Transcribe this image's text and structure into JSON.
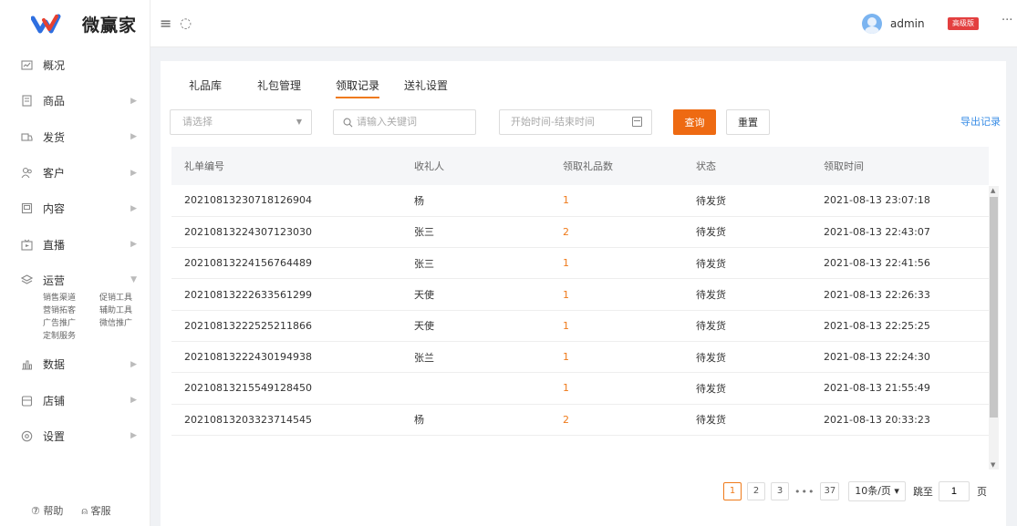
{
  "app": {
    "logo_text": "微赢家",
    "accent": "#ee6a12",
    "link": "#3a8ee6"
  },
  "sidebar": {
    "items": [
      {
        "label": "概况",
        "icon": "overview-icon",
        "arrow": ""
      },
      {
        "label": "商品",
        "icon": "goods-icon",
        "arrow": "▶"
      },
      {
        "label": "发货",
        "icon": "shipping-icon",
        "arrow": "▶"
      },
      {
        "label": "客户",
        "icon": "customer-icon",
        "arrow": "▶"
      },
      {
        "label": "内容",
        "icon": "content-icon",
        "arrow": "▶"
      },
      {
        "label": "直播",
        "icon": "live-icon",
        "arrow": "▶"
      },
      {
        "label": "运营",
        "icon": "operation-icon",
        "arrow": "▼"
      },
      {
        "label": "数据",
        "icon": "data-icon",
        "arrow": "▶"
      },
      {
        "label": "店铺",
        "icon": "shop-icon",
        "arrow": "▶"
      },
      {
        "label": "设置",
        "icon": "settings-icon",
        "arrow": "▶"
      }
    ],
    "sub_items": [
      "销售渠道",
      "促销工具",
      "营销拓客",
      "辅助工具",
      "广告推广",
      "微信推广",
      "定制服务"
    ],
    "footer": {
      "help": "⑦ 帮助",
      "service": "⍝ 客服"
    }
  },
  "header": {
    "username": "admin",
    "badge": "高级版",
    "more": "···"
  },
  "tabs": [
    "礼品库",
    "礼包管理",
    "领取记录",
    "送礼设置"
  ],
  "active_tab": "领取记录",
  "filters": {
    "select_placeholder": "请选择",
    "search_placeholder": "请输入关键词",
    "date_placeholder": "开始时间-结束时间",
    "query_label": "查询",
    "reset_label": "重置",
    "export_label": "导出记录"
  },
  "table": {
    "columns": [
      "礼单编号",
      "收礼人",
      "领取礼品数",
      "状态",
      "领取时间"
    ],
    "rows": [
      {
        "id": "20210813230718126904",
        "recipient": "杨",
        "count": "1",
        "status": "待发货",
        "time": "2021-08-13 23:07:18"
      },
      {
        "id": "20210813224307123030",
        "recipient": "张三",
        "count": "2",
        "status": "待发货",
        "time": "2021-08-13 22:43:07"
      },
      {
        "id": "20210813224156764489",
        "recipient": "张三",
        "count": "1",
        "status": "待发货",
        "time": "2021-08-13 22:41:56"
      },
      {
        "id": "20210813222633561299",
        "recipient": "天使",
        "count": "1",
        "status": "待发货",
        "time": "2021-08-13 22:26:33"
      },
      {
        "id": "20210813222525211866",
        "recipient": "天使",
        "count": "1",
        "status": "待发货",
        "time": "2021-08-13 22:25:25"
      },
      {
        "id": "20210813222430194938",
        "recipient": "张兰",
        "count": "1",
        "status": "待发货",
        "time": "2021-08-13 22:24:30"
      },
      {
        "id": "20210813215549128450",
        "recipient": "",
        "count": "1",
        "status": "待发货",
        "time": "2021-08-13 21:55:49"
      },
      {
        "id": "20210813203323714545",
        "recipient": "杨",
        "count": "2",
        "status": "待发货",
        "time": "2021-08-13 20:33:23"
      }
    ]
  },
  "pagination": {
    "pages": [
      "1",
      "2",
      "3"
    ],
    "current": "1",
    "ellipsis": "•••",
    "last_page": "37",
    "page_size": "10条/页 ▾",
    "jump_label": "跳至",
    "jump_value": "1",
    "page_unit": "页"
  }
}
